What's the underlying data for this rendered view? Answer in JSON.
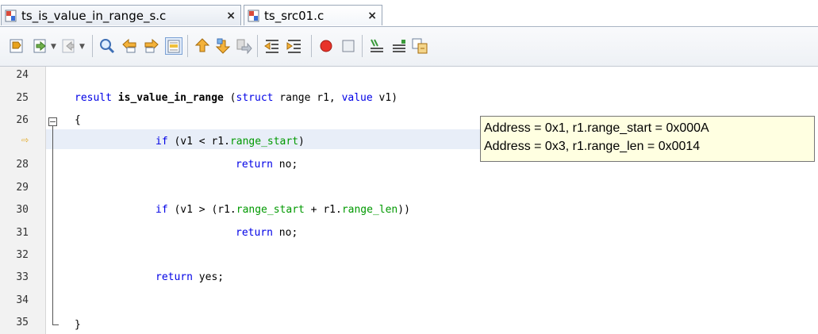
{
  "tabs": [
    {
      "label": "ts_is_value_in_range_s.c",
      "close": "×"
    },
    {
      "label": "ts_src01.c",
      "close": "×"
    }
  ],
  "toolbar": {
    "icons": [
      "toggle-bookmark-icon",
      "back-icon",
      "forward-icon",
      "find-icon",
      "find-previous-icon",
      "find-next-icon",
      "toggle-highlight-icon",
      "step-out-icon",
      "step-into-icon",
      "step-over-icon",
      "shift-left-icon",
      "shift-right-icon",
      "record-macro-icon",
      "stop-macro-icon",
      "comment-icon",
      "uncomment-icon",
      "diff-icon"
    ]
  },
  "editor": {
    "lines": [
      {
        "num": "24"
      },
      {
        "num": "25"
      },
      {
        "num": "26"
      },
      {
        "num": "⇨",
        "current": true
      },
      {
        "num": "28"
      },
      {
        "num": "29"
      },
      {
        "num": "30"
      },
      {
        "num": "31"
      },
      {
        "num": "32"
      },
      {
        "num": "33"
      },
      {
        "num": "34"
      },
      {
        "num": "35"
      }
    ],
    "code": {
      "l25_type": "result ",
      "l25_fn": "is_value_in_range",
      "l25_open": " (",
      "l25_struct": "struct",
      "l25_mid": " range r1, ",
      "l25_value": "value",
      "l25_end": " v1)",
      "l26": "{",
      "l27_if": "if",
      "l27_a": " (v1 < r1.",
      "l27_fld": "range_start",
      "l27_b": ")",
      "l28_ret": "return",
      "l28_b": " no;",
      "l30_if": "if",
      "l30_a": " (v1 > (r1.",
      "l30_fld1": "range_start",
      "l30_b": " + r1.",
      "l30_fld2": "range_len",
      "l30_c": "))",
      "l31_ret": "return",
      "l31_b": " no;",
      "l33_ret": "return",
      "l33_b": " yes;",
      "l35": "}"
    }
  },
  "tooltip": {
    "line1": "Address = 0x1,  r1.range_start = 0x000A",
    "line2": "Address = 0x3,  r1.range_len = 0x0014"
  },
  "colors": {
    "keyword": "#0000e6",
    "field": "#009900",
    "tooltip_bg": "#ffffe1",
    "current_line": "#e8eef8"
  }
}
